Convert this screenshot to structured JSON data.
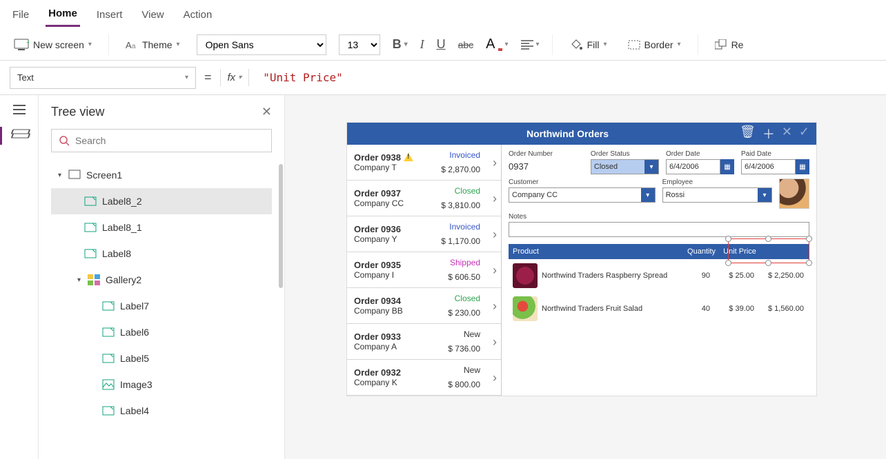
{
  "menu": {
    "file": "File",
    "home": "Home",
    "insert": "Insert",
    "view": "View",
    "action": "Action"
  },
  "ribbon": {
    "new_screen": "New screen",
    "theme": "Theme",
    "font": "Open Sans",
    "font_size": "13",
    "fill": "Fill",
    "border": "Border",
    "reorder": "Re"
  },
  "formula": {
    "property": "Text",
    "fx": "fx",
    "value": "\"Unit Price\""
  },
  "tree": {
    "title": "Tree view",
    "search_placeholder": "Search",
    "items": {
      "screen1": "Screen1",
      "label8_2": "Label8_2",
      "label8_1": "Label8_1",
      "label8": "Label8",
      "gallery2": "Gallery2",
      "label7": "Label7",
      "label6": "Label6",
      "label5": "Label5",
      "image3": "Image3",
      "label4": "Label4"
    }
  },
  "app": {
    "title": "Northwind Orders",
    "orders": [
      {
        "id": "Order 0938",
        "company": "Company T",
        "status": "Invoiced",
        "status_cls": "st-invoiced",
        "amount": "$ 2,870.00",
        "warn": true
      },
      {
        "id": "Order 0937",
        "company": "Company CC",
        "status": "Closed",
        "status_cls": "st-closed",
        "amount": "$ 3,810.00"
      },
      {
        "id": "Order 0936",
        "company": "Company Y",
        "status": "Invoiced",
        "status_cls": "st-invoiced",
        "amount": "$ 1,170.00"
      },
      {
        "id": "Order 0935",
        "company": "Company I",
        "status": "Shipped",
        "status_cls": "st-shipped",
        "amount": "$ 606.50"
      },
      {
        "id": "Order 0934",
        "company": "Company BB",
        "status": "Closed",
        "status_cls": "st-closed",
        "amount": "$ 230.00"
      },
      {
        "id": "Order 0933",
        "company": "Company A",
        "status": "New",
        "status_cls": "st-new",
        "amount": "$ 736.00"
      },
      {
        "id": "Order 0932",
        "company": "Company K",
        "status": "New",
        "status_cls": "st-new",
        "amount": "$ 800.00"
      }
    ],
    "detail": {
      "labels": {
        "order_number": "Order Number",
        "order_status": "Order Status",
        "order_date": "Order Date",
        "paid_date": "Paid Date",
        "customer": "Customer",
        "employee": "Employee",
        "notes": "Notes",
        "product": "Product",
        "quantity": "Quantity",
        "unit_price": "Unit Price"
      },
      "order_number": "0937",
      "order_status": "Closed",
      "order_date": "6/4/2006",
      "paid_date": "6/4/2006",
      "customer": "Company CC",
      "employee": "Rossi"
    },
    "products": [
      {
        "name": "Northwind Traders Raspberry Spread",
        "qty": "90",
        "unit": "$ 25.00",
        "ext": "$ 2,250.00",
        "img": "img-berry"
      },
      {
        "name": "Northwind Traders Fruit Salad",
        "qty": "40",
        "unit": "$ 39.00",
        "ext": "$ 1,560.00",
        "img": "img-salad"
      }
    ]
  }
}
